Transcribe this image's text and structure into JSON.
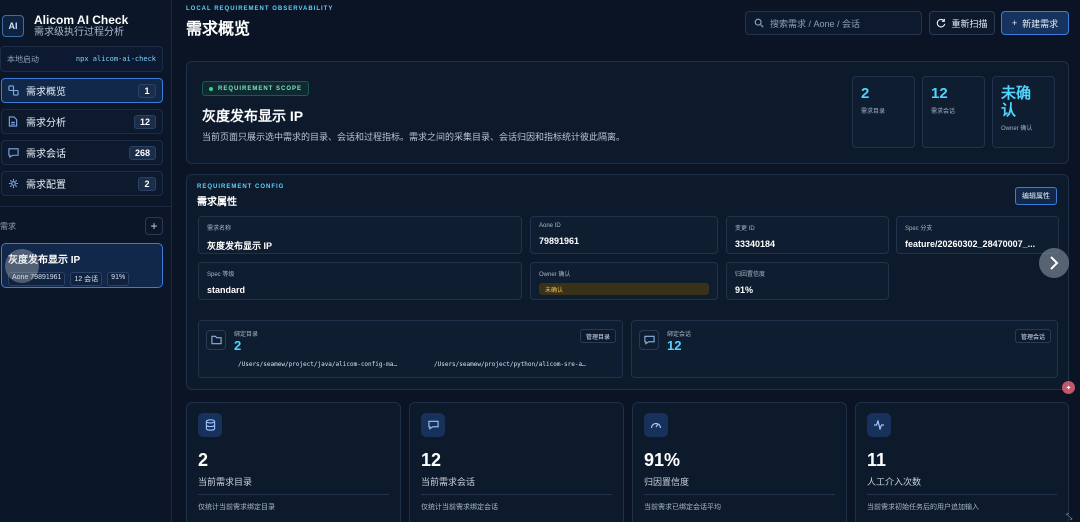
{
  "brand": {
    "logo": "AI",
    "title": "Alicom AI Check",
    "subtitle": "需求级执行过程分析"
  },
  "launch": {
    "label": "本地启动",
    "command": "npx alicom-ai-check"
  },
  "nav": [
    {
      "label": "需求概览",
      "count": "1",
      "icon": "link-icon",
      "active": true
    },
    {
      "label": "需求分析",
      "count": "12",
      "icon": "document-icon",
      "active": false
    },
    {
      "label": "需求会话",
      "count": "268",
      "icon": "chat-icon",
      "active": false
    },
    {
      "label": "需求配置",
      "count": "2",
      "icon": "gear-icon",
      "active": false
    }
  ],
  "requirements": {
    "label": "需求",
    "add_label": "+",
    "card": {
      "title": "灰度发布显示 IP",
      "aone": "Aone 79891961",
      "sessions": "12 会话",
      "confidence": "91%"
    }
  },
  "header": {
    "eyebrow": "LOCAL REQUIREMENT OBSERVABILITY",
    "title": "需求概览",
    "search_placeholder": "搜索需求 / Aone / 会话",
    "rescan_label": "重新扫描",
    "new_label": "新建需求"
  },
  "scope": {
    "pill": "REQUIREMENT SCOPE",
    "title": "灰度发布显示 IP",
    "desc": "当前页面只展示选中需求的目录、会话和过程指标。需求之间的采集目录、会话归因和指标统计彼此隔离。",
    "stats": [
      {
        "value": "2",
        "label": "需求目录"
      },
      {
        "value": "12",
        "label": "需求会话"
      },
      {
        "value": "未确认",
        "label": "Owner 确认"
      }
    ]
  },
  "config": {
    "eyebrow": "REQUIREMENT CONFIG",
    "title": "需求属性",
    "edit_label": "编辑属性",
    "fields": [
      {
        "key": "需求名称",
        "value": "灰度发布显示 IP"
      },
      {
        "key": "Aone ID",
        "value": "79891961"
      },
      {
        "key": "变更 ID",
        "value": "33340184"
      },
      {
        "key": "Spec 分支",
        "value": "feature/20260302_28470007_..."
      },
      {
        "key": "Spec 等级",
        "value": "standard"
      },
      {
        "key": "Owner 确认",
        "value": "未确认"
      },
      {
        "key": "归因置信度",
        "value": "91%"
      }
    ],
    "bind_dirs": {
      "label": "绑定目录",
      "value": "2",
      "button": "管理目录",
      "paths": [
        "/Users/seamew/project/java/alicom-config-ma…",
        "/Users/seamew/project/python/alicom-sre-a…"
      ]
    },
    "bind_sessions": {
      "label": "绑定会话",
      "value": "12",
      "button": "管理会话"
    }
  },
  "metrics": [
    {
      "icon": "database-icon",
      "value": "2",
      "label": "当前需求目录",
      "desc": "仅统计当前需求绑定目录"
    },
    {
      "icon": "chat-icon",
      "value": "12",
      "label": "当前需求会话",
      "desc": "仅统计当前需求绑定会话"
    },
    {
      "icon": "gauge-icon",
      "value": "91%",
      "label": "归因置信度",
      "desc": "当前需求已绑定会话平均"
    },
    {
      "icon": "pulse-icon",
      "value": "11",
      "label": "人工介入次数",
      "desc": "当前需求初始任务后的用户追加输入"
    }
  ]
}
